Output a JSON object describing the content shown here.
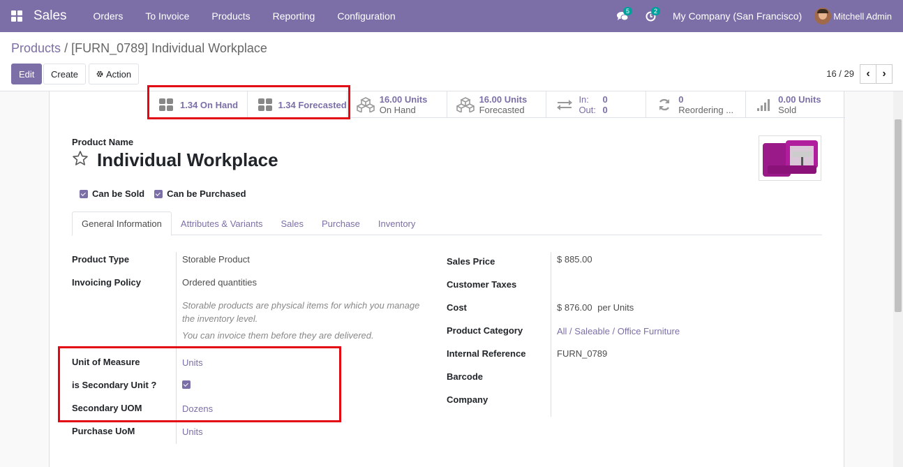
{
  "navbar": {
    "brand": "Sales",
    "menu": [
      "Orders",
      "To Invoice",
      "Products",
      "Reporting",
      "Configuration"
    ],
    "messages_count": "5",
    "activities_count": "2",
    "company": "My Company (San Francisco)",
    "user": "Mitchell Admin"
  },
  "breadcrumb": {
    "parent": "Products",
    "separator": "/",
    "current": "[FURN_0789] Individual Workplace"
  },
  "toolbar": {
    "edit": "Edit",
    "create": "Create",
    "action": "Action"
  },
  "pager": {
    "value": "16 / 29"
  },
  "smart_buttons": {
    "on_hand": "1.34 On Hand",
    "forecasted": "1.34 Forecasted",
    "units_on_hand_value": "16.00 Units",
    "units_on_hand_label": "On Hand",
    "units_forecast_value": "16.00 Units",
    "units_forecast_label": "Forecasted",
    "in_label": "In:",
    "in_value": "0",
    "out_label": "Out:",
    "out_value": "0",
    "reordering_value": "0",
    "reordering_label": "Reordering ...",
    "sold_value": "0.00 Units",
    "sold_label": "Sold"
  },
  "product": {
    "name_label": "Product Name",
    "name": "Individual Workplace",
    "can_be_sold": "Can be Sold",
    "can_be_purchased": "Can be Purchased"
  },
  "tabs": [
    "General Information",
    "Attributes & Variants",
    "Sales",
    "Purchase",
    "Inventory"
  ],
  "left_fields": {
    "product_type_label": "Product Type",
    "product_type": "Storable Product",
    "invoicing_policy_label": "Invoicing Policy",
    "invoicing_policy": "Ordered quantities",
    "help1": "Storable products are physical items for which you manage the inventory level.",
    "help2": "You can invoice them before they are delivered.",
    "uom_label": "Unit of Measure",
    "uom": "Units",
    "secondary_unit_label": "is Secondary Unit ?",
    "secondary_uom_label": "Secondary UOM",
    "secondary_uom": "Dozens",
    "purchase_uom_label": "Purchase UoM",
    "purchase_uom": "Units"
  },
  "right_fields": {
    "sales_price_label": "Sales Price",
    "sales_price": "$ 885.00",
    "customer_taxes_label": "Customer Taxes",
    "cost_label": "Cost",
    "cost": "$ 876.00",
    "cost_unit": "per Units",
    "category_label": "Product Category",
    "category": "All / Saleable / Office Furniture",
    "internal_ref_label": "Internal Reference",
    "internal_ref": "FURN_0789",
    "barcode_label": "Barcode",
    "company_label": "Company"
  },
  "colors": {
    "brand": "#7c6fa7",
    "highlight": "#e30613"
  }
}
